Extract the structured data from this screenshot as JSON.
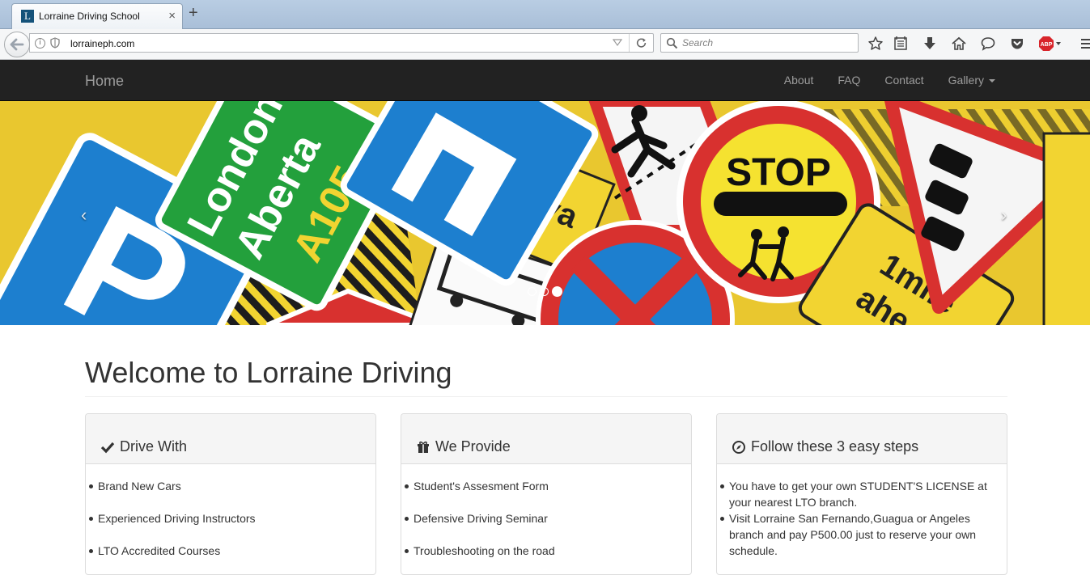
{
  "browser": {
    "tab_title": "Lorraine Driving School",
    "tab_favicon_letter": "L",
    "close_label": "×",
    "new_tab_label": "+",
    "url": "lorraineph.com",
    "search_placeholder": "Search",
    "abp_badge": "ABP"
  },
  "navbar": {
    "brand": "Home",
    "links": [
      "About",
      "FAQ",
      "Contact"
    ],
    "dropdown": "Gallery"
  },
  "carousel": {
    "prev_label": "‹",
    "next_label": "›",
    "slide_count": 3,
    "active_slide": 3,
    "sign_text": {
      "stop": "STOP",
      "parking": "P",
      "green_line1": "London",
      "green_line2": "Aberta",
      "green_line3": "A105",
      "mile_line1": "1mile",
      "mile_line2": "ahe"
    }
  },
  "main": {
    "title": "Welcome to Lorraine Driving",
    "panels": [
      {
        "icon": "check-icon",
        "title": "Drive With",
        "items": [
          "Brand New Cars",
          "Experienced Driving Instructors",
          "LTO Accredited Courses"
        ]
      },
      {
        "icon": "gift-icon",
        "title": "We Provide",
        "items": [
          "Student's Assesment Form",
          "Defensive Driving Seminar",
          "Troubleshooting on the road"
        ]
      },
      {
        "icon": "compass-icon",
        "title": "Follow these 3 easy steps",
        "items": [
          "You have to get your own STUDENT'S LICENSE at your nearest LTO branch.",
          "Visit Lorraine San Fernando,Guagua or Angeles branch and pay P500.00 just to reserve your own schedule."
        ]
      }
    ]
  },
  "colors": {
    "navbar_bg": "#222222",
    "navbar_text": "#9d9d9d",
    "panel_heading_bg": "#f5f5f5"
  }
}
